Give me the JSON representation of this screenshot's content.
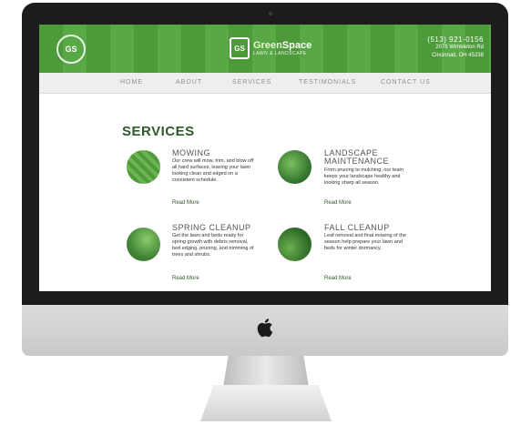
{
  "site": {
    "logo_mark": "GS",
    "seal_text": "GS",
    "brand_part1": "Green",
    "brand_part2": "Space",
    "brand_tagline": "LAWN & LANDSCAPE",
    "phone": "(513) 921-0156",
    "address_line1": "2075 Wimbleton Rd",
    "address_line2": "Cincinnati, OH 45238"
  },
  "nav": {
    "items": [
      "HOME",
      "ABOUT",
      "SERVICES",
      "TESTIMONIALS",
      "CONTACT US"
    ]
  },
  "services": {
    "heading": "SERVICES",
    "items": [
      {
        "title": "MOWING",
        "desc": "Our crew will mow, trim, and blow off all hard surfaces, leaving your lawn looking clean and edged on a consistent schedule.",
        "more": "Read More"
      },
      {
        "title": "LANDSCAPE\nMAINTENANCE",
        "desc": "From pruning to mulching, our team keeps your landscape healthy and looking sharp all season.",
        "more": "Read More"
      },
      {
        "title": "SPRING CLEANUP",
        "desc": "Get the lawn and beds ready for spring growth with debris removal, bed edging, pruning, and trimming of trees and shrubs.",
        "more": "Read More"
      },
      {
        "title": "FALL CLEANUP",
        "desc": "Leaf removal and final mowing of the season help prepare your lawn and beds for winter dormancy.",
        "more": "Read More"
      }
    ]
  }
}
